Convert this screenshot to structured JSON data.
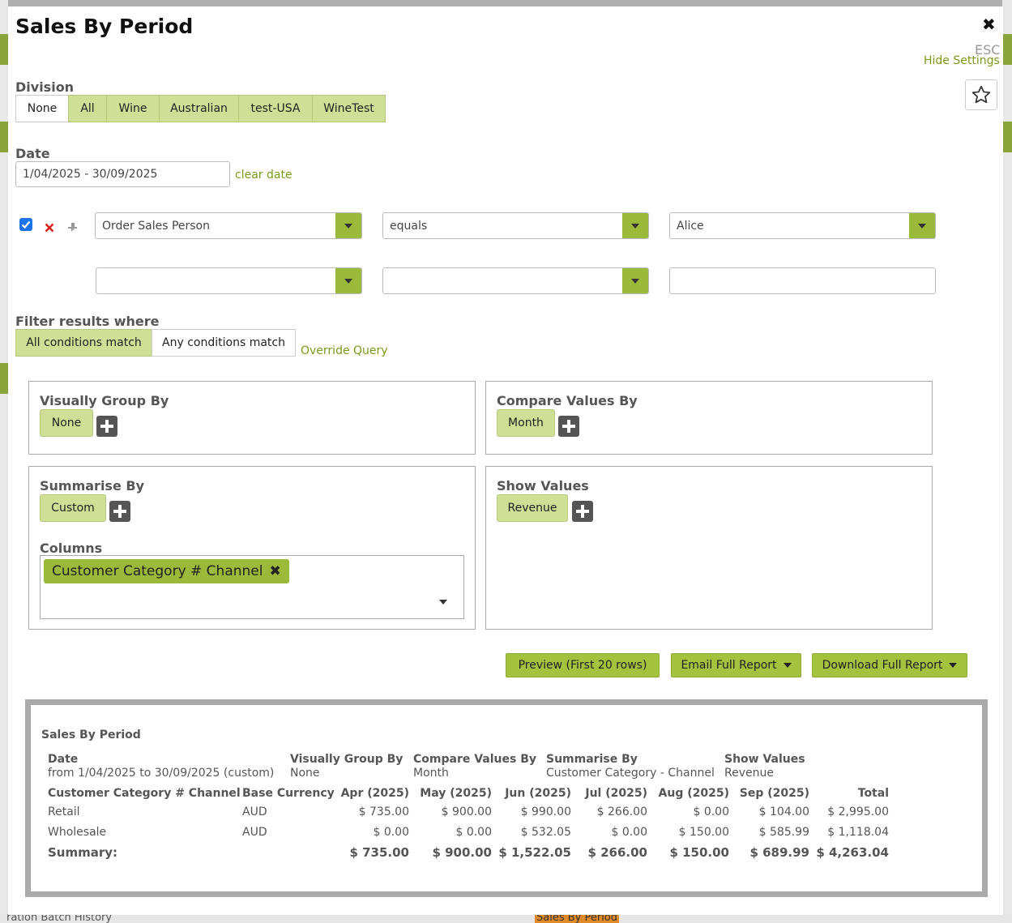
{
  "background": {
    "bottom_left_text": "ration Batch History",
    "bottom_right_text": "Sales By Period"
  },
  "modal": {
    "title": "Sales By Period",
    "close_icon": "close-icon",
    "esc_label": "ESC",
    "hide_settings": "Hide Settings",
    "favorite_icon": "star-icon"
  },
  "division": {
    "label": "Division",
    "options": [
      "None",
      "All",
      "Wine",
      "Australian",
      "test-USA",
      "WineTest"
    ],
    "selected": "None"
  },
  "date": {
    "label": "Date",
    "value": "1/04/2025 - 30/09/2025",
    "clear_label": "clear date"
  },
  "conditions": {
    "row1": {
      "enabled": true,
      "field": "Order Sales Person",
      "operator": "equals",
      "value": "Alice"
    },
    "row2": {
      "field": "",
      "operator": "",
      "value": ""
    }
  },
  "filter": {
    "label": "Filter results where",
    "all_label": "All conditions match",
    "any_label": "Any conditions match",
    "selected": "All conditions match",
    "override_label": "Override Query"
  },
  "visually_group_by": {
    "title": "Visually Group By",
    "value": "None"
  },
  "compare_values_by": {
    "title": "Compare Values By",
    "value": "Month"
  },
  "summarise_by": {
    "title": "Summarise By",
    "value": "Custom",
    "columns_label": "Columns",
    "column_chip": "Customer Category # Channel"
  },
  "show_values": {
    "title": "Show Values",
    "value": "Revenue"
  },
  "actions": {
    "preview": "Preview (First 20 rows)",
    "email": "Email Full Report",
    "download": "Download Full Report"
  },
  "report": {
    "title": "Sales By Period",
    "meta": {
      "date_label": "Date",
      "date_value": "from 1/04/2025 to 30/09/2025 (custom)",
      "group_label": "Visually Group By",
      "group_value": "None",
      "compare_label": "Compare Values By",
      "compare_value": "Month",
      "summarise_label": "Summarise By",
      "summarise_value": "Customer Category - Channel",
      "show_label": "Show Values",
      "show_value": "Revenue"
    },
    "headers": [
      "Customer Category # Channel",
      "Base Currency",
      "Apr (2025)",
      "May (2025)",
      "Jun (2025)",
      "Jul (2025)",
      "Aug (2025)",
      "Sep (2025)",
      "Total"
    ],
    "rows": [
      [
        "Retail",
        "AUD",
        "$ 735.00",
        "$ 900.00",
        "$ 990.00",
        "$ 266.00",
        "$ 0.00",
        "$ 104.00",
        "$ 2,995.00"
      ],
      [
        "Wholesale",
        "AUD",
        "$ 0.00",
        "$ 0.00",
        "$ 532.05",
        "$ 0.00",
        "$ 150.00",
        "$ 585.99",
        "$ 1,118.04"
      ]
    ],
    "summary": [
      "Summary:",
      "",
      "$ 735.00",
      "$ 900.00",
      "$ 1,522.05",
      "$ 266.00",
      "$ 150.00",
      "$ 689.99",
      "$ 4,263.04"
    ]
  }
}
